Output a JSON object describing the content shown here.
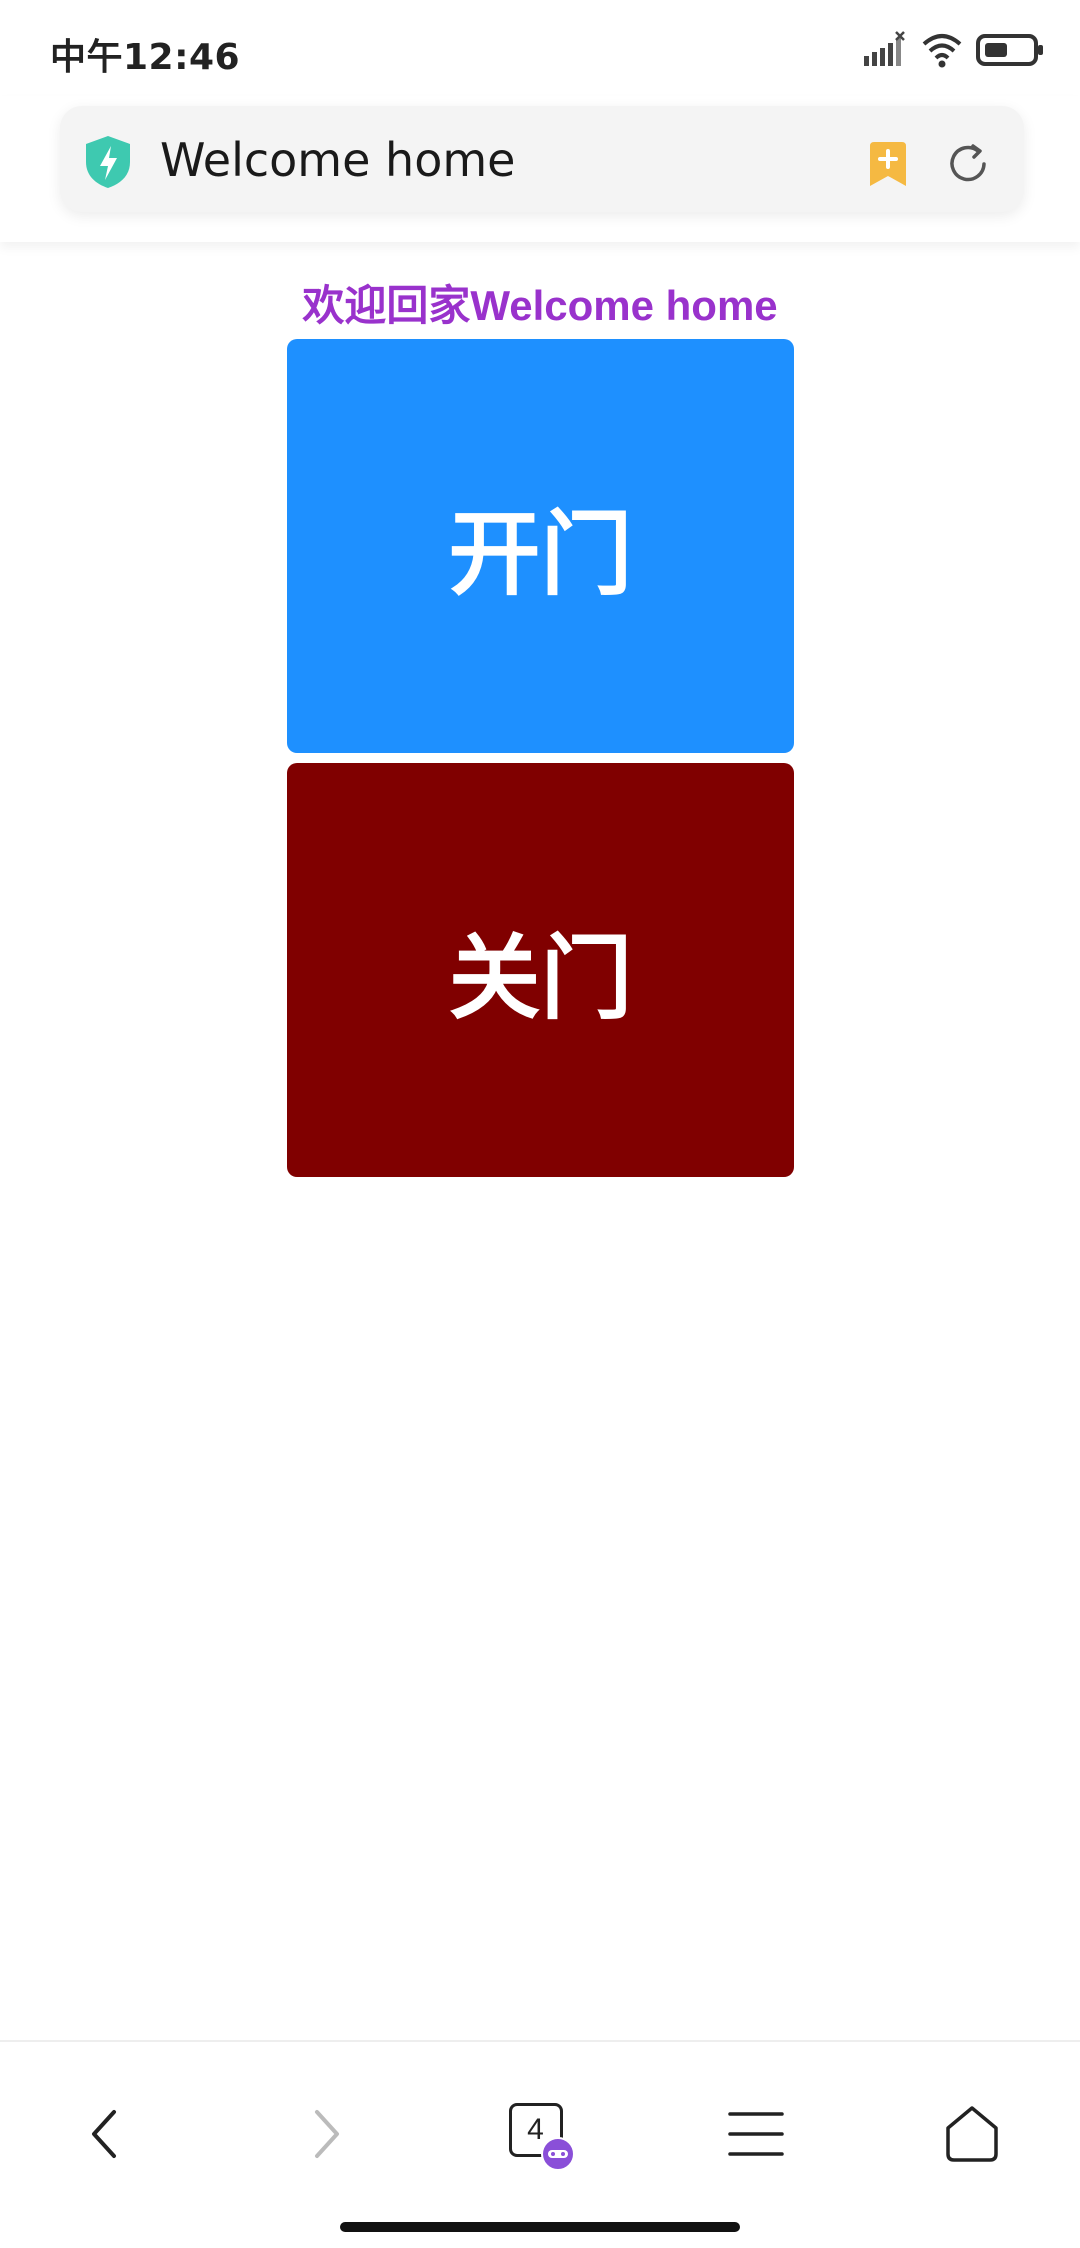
{
  "status_bar": {
    "time": "中午12:46",
    "icons": [
      "signal-icon",
      "wifi-icon",
      "battery-icon"
    ]
  },
  "browser": {
    "page_title": "Welcome home",
    "tab_count": "4",
    "icons": [
      "shield-icon",
      "bookmark-add-icon",
      "refresh-icon",
      "back-icon",
      "forward-icon",
      "tabs-icon",
      "menu-icon",
      "home-icon"
    ]
  },
  "page": {
    "heading": "欢迎回家Welcome home",
    "open_button": "开门",
    "close_button": "关门"
  },
  "colors": {
    "heading": "#9932cc",
    "open_button": "#1e90ff",
    "close_button": "#800000",
    "shield": "#3ec9b0",
    "bookmark": "#f5b942",
    "incognito_badge": "#8a4fd8"
  }
}
